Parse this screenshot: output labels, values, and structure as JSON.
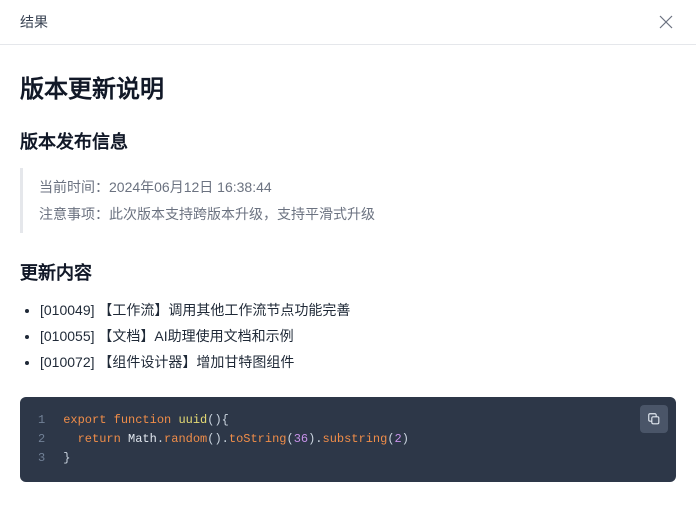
{
  "header": {
    "title": "结果"
  },
  "doc": {
    "h1": "版本更新说明",
    "section_release": {
      "heading": "版本发布信息",
      "time_label": "当前时间：",
      "time_value": "2024年06月12日 16:38:44",
      "notice_label": "注意事项：",
      "notice_value": "此次版本支持跨版本升级，支持平滑式升级"
    },
    "section_changes": {
      "heading": "更新内容",
      "items": [
        "[010049] 【工作流】调用其他工作流节点功能完善",
        "[010055] 【文档】AI助理使用文档和示例",
        "[010072] 【组件设计器】增加甘特图组件"
      ]
    },
    "code": {
      "line_numbers": [
        "1",
        "2",
        "3"
      ],
      "tokens": {
        "l1": {
          "export": "export",
          "function": "function",
          "name": "uuid",
          "p1": "(",
          "p2": ")",
          "p3": "{"
        },
        "l2": {
          "ret": "return",
          "obj": "Math",
          "dot1": ".",
          "m1": "random",
          "p1": "(",
          "p2": ")",
          "dot2": ".",
          "m2": "toString",
          "p3": "(",
          "n1": "36",
          "p4": ")",
          "dot3": ".",
          "m3": "substring",
          "p5": "(",
          "n2": "2",
          "p6": ")"
        },
        "l3": {
          "p1": "}"
        }
      }
    }
  },
  "chart_data": null
}
